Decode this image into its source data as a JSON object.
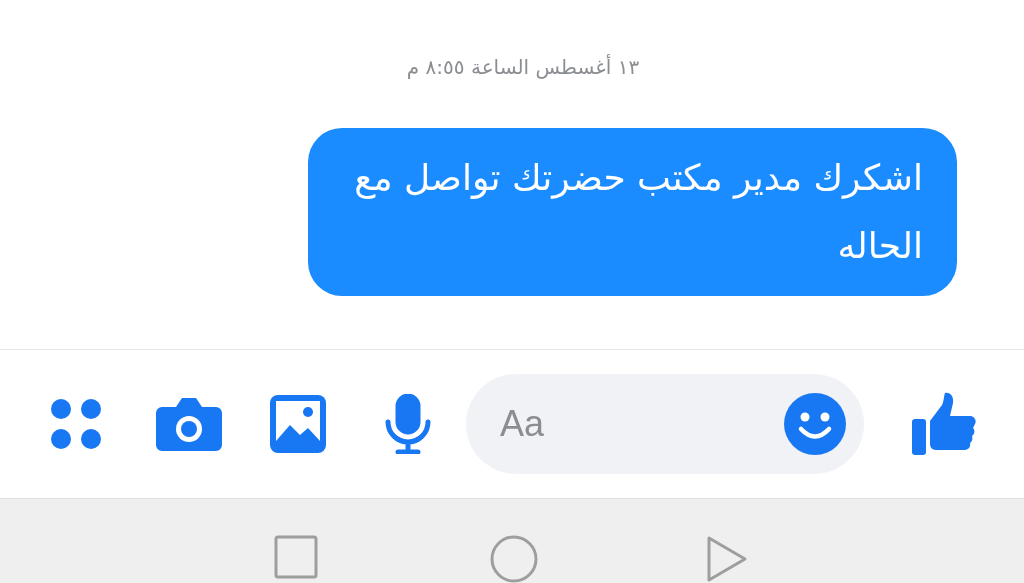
{
  "timestamp": "١٣ أغسطس الساعة ٨:٥٥ م",
  "messages": [
    {
      "text": "اشكرك مدير مكتب حضرتك  تواصل مع الحاله",
      "outgoing": true
    }
  ],
  "composer": {
    "placeholder": "Aa"
  }
}
